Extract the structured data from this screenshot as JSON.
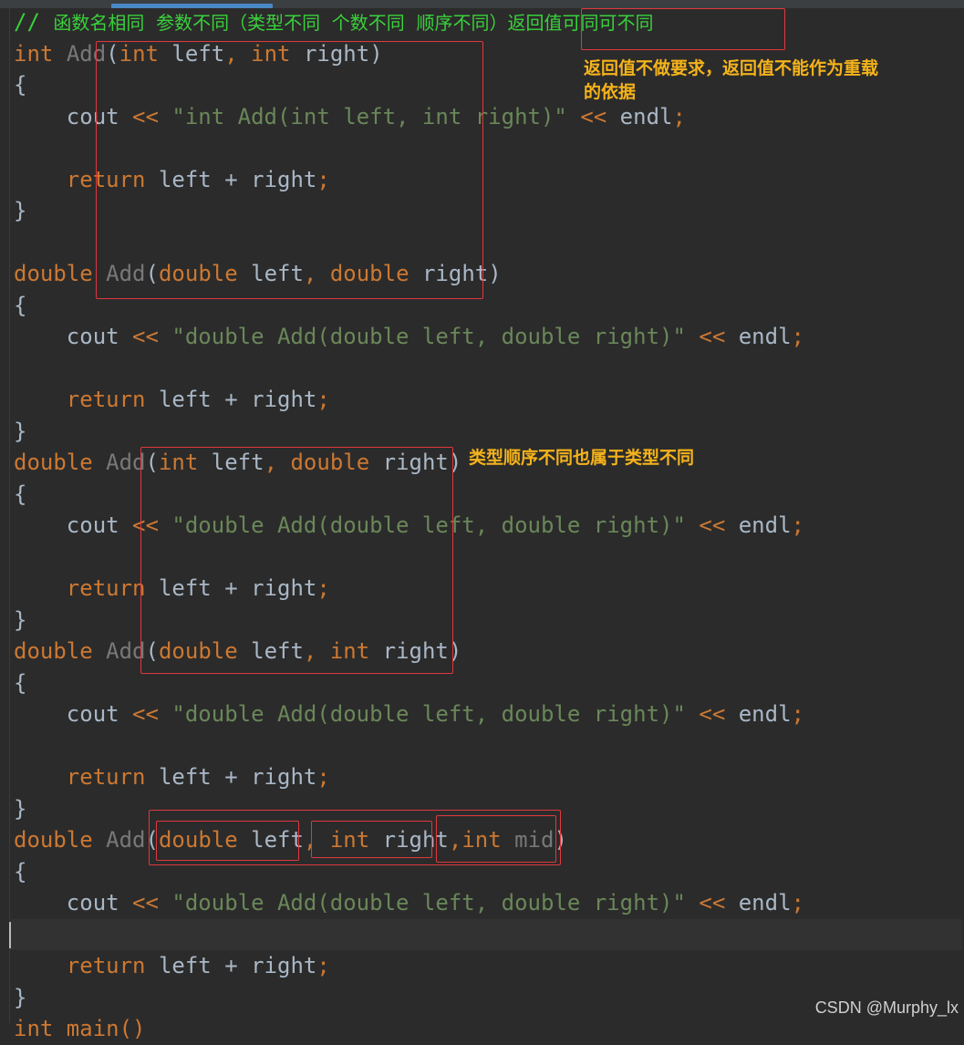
{
  "comment": {
    "slashes": "// ",
    "text": "函数名相同  参数不同（类型不同  个数不同  顺序不同）",
    "boxed": "返回值可同可不同"
  },
  "notes": {
    "return_note_1": "返回值不做要求，返回值不能作为重载",
    "return_note_2": "的依据",
    "order_note": "类型顺序不同也属于类型不同"
  },
  "code": {
    "int_kw": "int",
    "double_kw": "double",
    "fn_name": "Add",
    "cout": "cout",
    "endl": "endl",
    "return_kw": "return",
    "return_expr": " left + right",
    "semicolon": ";",
    "brace_open": "{",
    "brace_close": "}",
    "shift": " << ",
    "left_param": " left",
    "right_param": " right",
    "mid_param": " mid",
    "comma": ", ",
    "comma_tight": ",",
    "paren_open": "(",
    "paren_close": ")",
    "str_int": "\"int Add(int left, int right)\"",
    "str_double": "\"double Add(double left, double right)\"",
    "partial_main": "int main()"
  },
  "watermark": "CSDN @Murphy_lx"
}
